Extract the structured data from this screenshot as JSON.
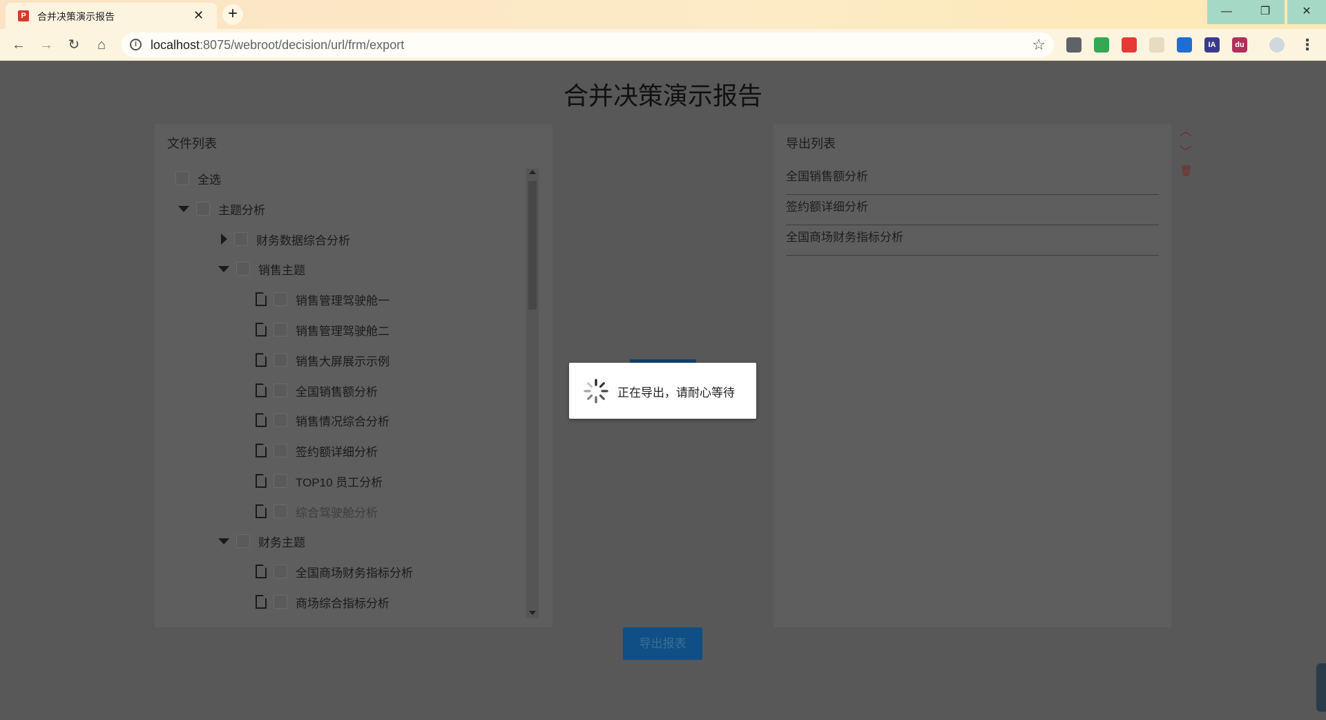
{
  "browser": {
    "tab_title": "合并决策演示报告",
    "tab_close": "✕",
    "new_tab": "+",
    "url_host": "localhost",
    "url_rest": ":8075/webroot/decision/url/frm/export",
    "window_min": "—",
    "window_max": "❐",
    "window_close": "✕",
    "extensions": [
      {
        "name": "ext-ghost-icon",
        "label": "",
        "color": "#5f6368"
      },
      {
        "name": "ext-chrome-icon",
        "label": "",
        "color": "#34a853"
      },
      {
        "name": "ext-red-icon",
        "label": "",
        "color": "#e53935"
      },
      {
        "name": "ext-light-icon",
        "label": "",
        "color": "#e8dcc0"
      },
      {
        "name": "ext-blue-icon",
        "label": "",
        "color": "#1e6fd0"
      },
      {
        "name": "ext-ia-icon",
        "label": "IA",
        "color": "#3a3a8c"
      },
      {
        "name": "ext-du-icon",
        "label": "du",
        "color": "#b0305c"
      },
      {
        "name": "ext-profile-icon",
        "label": "",
        "color": "#cfd8dc"
      }
    ]
  },
  "page": {
    "title": "合并决策演示报告"
  },
  "file_list": {
    "title": "文件列表",
    "items": [
      {
        "label": "全选",
        "type": "checkbox-only",
        "depth": 0
      },
      {
        "label": "主题分析",
        "type": "folder-open",
        "depth": 0
      },
      {
        "label": "财务数据综合分析",
        "type": "folder-closed",
        "depth": 1
      },
      {
        "label": "销售主题",
        "type": "folder-open",
        "depth": 1
      },
      {
        "label": "销售管理驾驶舱一",
        "type": "file",
        "depth": 2
      },
      {
        "label": "销售管理驾驶舱二",
        "type": "file",
        "depth": 2
      },
      {
        "label": "销售大屏展示示例",
        "type": "file",
        "depth": 2
      },
      {
        "label": "全国销售额分析",
        "type": "file",
        "depth": 2
      },
      {
        "label": "销售情况综合分析",
        "type": "file",
        "depth": 2
      },
      {
        "label": "签约额详细分析",
        "type": "file",
        "depth": 2
      },
      {
        "label": "TOP10 员工分析",
        "type": "file",
        "depth": 2
      },
      {
        "label": "综合驾驶舱分析",
        "type": "file",
        "depth": 2,
        "muted": true
      },
      {
        "label": "财务主题",
        "type": "folder-open",
        "depth": 1
      },
      {
        "label": "全国商场财务指标分析",
        "type": "file",
        "depth": 2
      },
      {
        "label": "商场综合指标分析",
        "type": "file",
        "depth": 2
      }
    ]
  },
  "export_list": {
    "title": "导出列表",
    "items": [
      "全国销售额分析",
      "签约额详细分析",
      "全国商场财务指标分析"
    ],
    "move_up": "︿",
    "move_down": "﹀",
    "delete": "🗑"
  },
  "export_button": "导出报表",
  "loading": {
    "text": "正在导出，请耐心等待"
  }
}
